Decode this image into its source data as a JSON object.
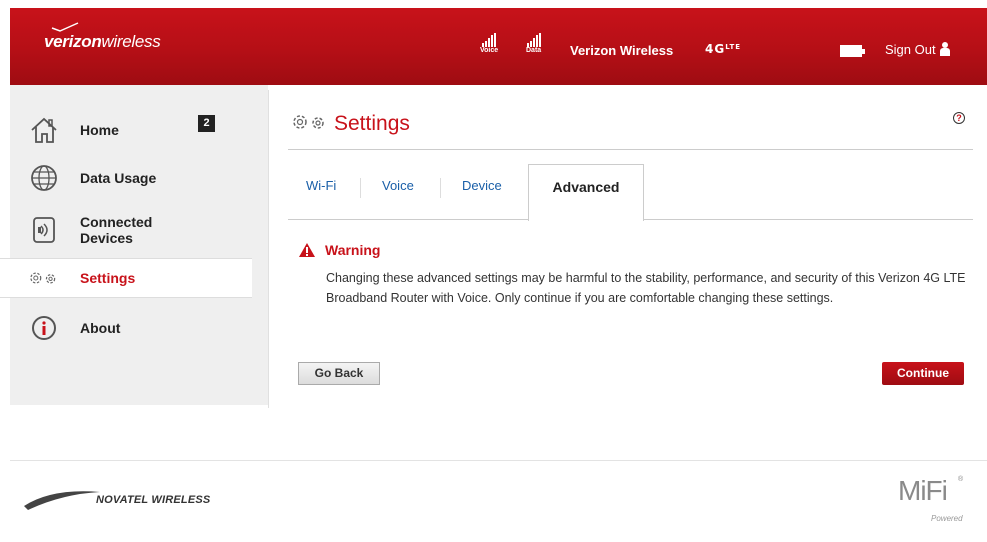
{
  "header": {
    "logo_brand": "verizon",
    "logo_suffix": "wireless",
    "voice_label": "Voice",
    "data_label": "Data",
    "carrier": "Verizon Wireless",
    "network": "4G",
    "network_suffix": "LTE",
    "signout_label": "Sign Out"
  },
  "sidebar": {
    "items": [
      {
        "label": "Home",
        "icon": "home-icon"
      },
      {
        "label": "Data Usage",
        "icon": "globe-icon"
      },
      {
        "label": "Connected Devices",
        "icon": "devices-icon"
      },
      {
        "label": "Settings",
        "icon": "gears-icon"
      },
      {
        "label": "About",
        "icon": "info-icon"
      }
    ],
    "connected_count": "2"
  },
  "main": {
    "title": "Settings",
    "help_label": "?",
    "tabs": [
      {
        "label": "Wi-Fi"
      },
      {
        "label": "Voice"
      },
      {
        "label": "Device"
      },
      {
        "label": "Advanced"
      }
    ],
    "active_tab": "Advanced",
    "warning": {
      "title": "Warning",
      "text": "Changing these advanced settings may be harmful to the stability, performance, and security of this Verizon 4G LTE Broadband Router with Voice. Only continue if you are comfortable changing these settings."
    },
    "buttons": {
      "back": "Go Back",
      "continue": "Continue"
    }
  },
  "footer": {
    "novatel": "NOVATEL WIRELESS",
    "mifi": "MiFi",
    "mifi_reg": "®",
    "powered": "Powered"
  },
  "colors": {
    "brand_red": "#c8121a",
    "link_blue": "#1a5fa8"
  }
}
